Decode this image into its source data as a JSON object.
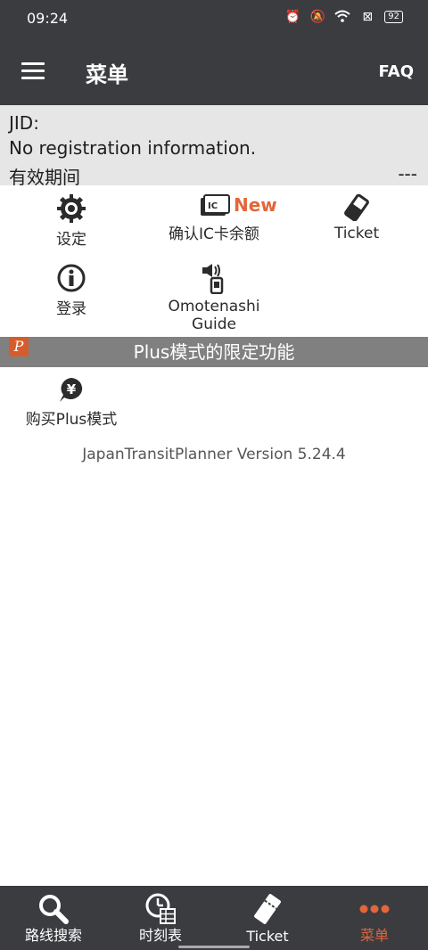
{
  "status": {
    "time": "09:24",
    "battery": "92"
  },
  "header": {
    "title": "菜单",
    "faq": "FAQ"
  },
  "info": {
    "jid_label": "JID:",
    "registration": "No registration information.",
    "validity_label": "有效期间",
    "validity_value": "---"
  },
  "menu": {
    "settings": "设定",
    "ic_balance": "确认IC卡余额",
    "new_badge": "New",
    "ticket": "Ticket",
    "login": "登录",
    "omotenashi_line1": "Omotenashi",
    "omotenashi_line2": "Guide"
  },
  "plus": {
    "badge": "P",
    "title": "Plus模式的限定功能",
    "buy": "购买Plus模式"
  },
  "version": "JapanTransitPlanner Version 5.24.4",
  "tabs": [
    {
      "label": "路线搜索",
      "icon": "search-icon"
    },
    {
      "label": "时刻表",
      "icon": "timetable-icon"
    },
    {
      "label": "Ticket",
      "icon": "ticket-icon"
    },
    {
      "label": "菜单",
      "icon": "more-icon"
    }
  ],
  "colors": {
    "accent": "#e2663a",
    "bar": "#3b3c40",
    "plus_bar": "#808080"
  }
}
